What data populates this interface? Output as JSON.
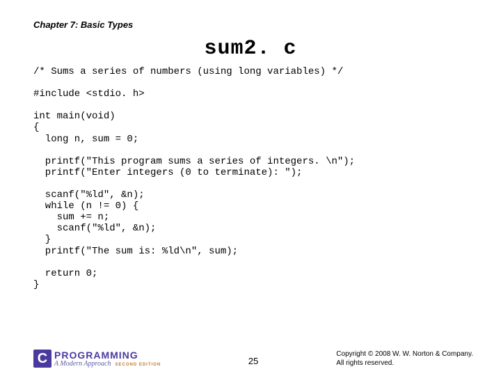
{
  "header": {
    "chapter": "Chapter 7: Basic Types"
  },
  "title": "sum2. c",
  "code": "/* Sums a series of numbers (using long variables) */\n\n#include <stdio. h>\n\nint main(void)\n{\n  long n, sum = 0;\n\n  printf(\"This program sums a series of integers. \\n\");\n  printf(\"Enter integers (0 to terminate): \");\n\n  scanf(\"%ld\", &n);\n  while (n != 0) {\n    sum += n;\n    scanf(\"%ld\", &n);\n  }\n  printf(\"The sum is: %ld\\n\", sum);\n\n  return 0;\n}",
  "footer": {
    "logo_letter": "C",
    "logo_word": "PROGRAMMING",
    "logo_sub": "A Modern Approach",
    "logo_edition": "SECOND EDITION",
    "page_number": "25",
    "copyright_line1": "Copyright © 2008 W. W. Norton & Company.",
    "copyright_line2": "All rights reserved."
  }
}
